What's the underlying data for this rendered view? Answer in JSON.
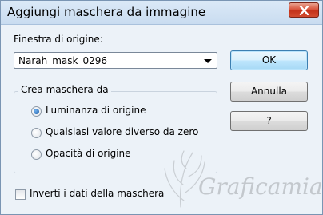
{
  "window": {
    "title": "Aggiungi maschera da immagine"
  },
  "source": {
    "label": "Finestra di origine:",
    "selected": "Narah_mask_0296"
  },
  "group": {
    "title": "Crea maschera da",
    "options": [
      {
        "label": "Luminanza di origine",
        "checked": true
      },
      {
        "label": "Qualsiasi valore diverso da zero",
        "checked": false
      },
      {
        "label": "Opacità di origine",
        "checked": false
      }
    ]
  },
  "invert": {
    "label": "Inverti i dati della maschera",
    "checked": false
  },
  "buttons": {
    "ok": "OK",
    "cancel": "Annulla",
    "help": "?"
  },
  "watermark": {
    "text": "Graficamia"
  },
  "colors": {
    "dialog_bg": "#ecf2f8",
    "close_button": "#c4321a",
    "radio_selected": "#1b5aa3"
  },
  "icons": {
    "close": "close-icon",
    "dropdown": "chevron-down-icon"
  }
}
